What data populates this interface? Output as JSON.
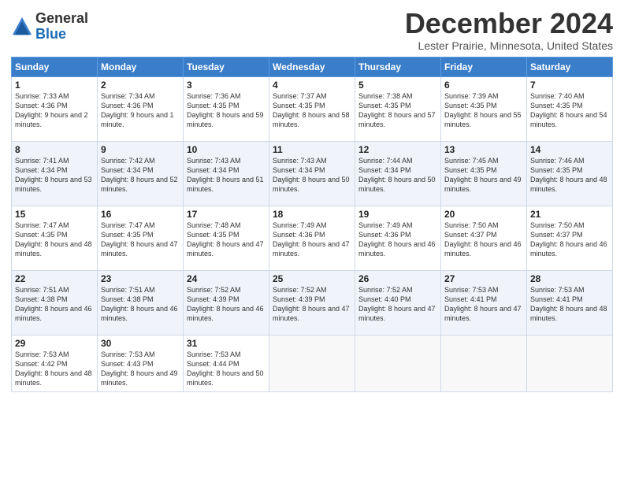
{
  "header": {
    "logo_general": "General",
    "logo_blue": "Blue",
    "month_title": "December 2024",
    "location": "Lester Prairie, Minnesota, United States"
  },
  "weekdays": [
    "Sunday",
    "Monday",
    "Tuesday",
    "Wednesday",
    "Thursday",
    "Friday",
    "Saturday"
  ],
  "weeks": [
    [
      {
        "day": "1",
        "sunrise": "7:33 AM",
        "sunset": "4:36 PM",
        "daylight": "9 hours and 2 minutes."
      },
      {
        "day": "2",
        "sunrise": "7:34 AM",
        "sunset": "4:36 PM",
        "daylight": "9 hours and 1 minute."
      },
      {
        "day": "3",
        "sunrise": "7:36 AM",
        "sunset": "4:35 PM",
        "daylight": "8 hours and 59 minutes."
      },
      {
        "day": "4",
        "sunrise": "7:37 AM",
        "sunset": "4:35 PM",
        "daylight": "8 hours and 58 minutes."
      },
      {
        "day": "5",
        "sunrise": "7:38 AM",
        "sunset": "4:35 PM",
        "daylight": "8 hours and 57 minutes."
      },
      {
        "day": "6",
        "sunrise": "7:39 AM",
        "sunset": "4:35 PM",
        "daylight": "8 hours and 55 minutes."
      },
      {
        "day": "7",
        "sunrise": "7:40 AM",
        "sunset": "4:35 PM",
        "daylight": "8 hours and 54 minutes."
      }
    ],
    [
      {
        "day": "8",
        "sunrise": "7:41 AM",
        "sunset": "4:34 PM",
        "daylight": "8 hours and 53 minutes."
      },
      {
        "day": "9",
        "sunrise": "7:42 AM",
        "sunset": "4:34 PM",
        "daylight": "8 hours and 52 minutes."
      },
      {
        "day": "10",
        "sunrise": "7:43 AM",
        "sunset": "4:34 PM",
        "daylight": "8 hours and 51 minutes."
      },
      {
        "day": "11",
        "sunrise": "7:43 AM",
        "sunset": "4:34 PM",
        "daylight": "8 hours and 50 minutes."
      },
      {
        "day": "12",
        "sunrise": "7:44 AM",
        "sunset": "4:34 PM",
        "daylight": "8 hours and 50 minutes."
      },
      {
        "day": "13",
        "sunrise": "7:45 AM",
        "sunset": "4:35 PM",
        "daylight": "8 hours and 49 minutes."
      },
      {
        "day": "14",
        "sunrise": "7:46 AM",
        "sunset": "4:35 PM",
        "daylight": "8 hours and 48 minutes."
      }
    ],
    [
      {
        "day": "15",
        "sunrise": "7:47 AM",
        "sunset": "4:35 PM",
        "daylight": "8 hours and 48 minutes."
      },
      {
        "day": "16",
        "sunrise": "7:47 AM",
        "sunset": "4:35 PM",
        "daylight": "8 hours and 47 minutes."
      },
      {
        "day": "17",
        "sunrise": "7:48 AM",
        "sunset": "4:35 PM",
        "daylight": "8 hours and 47 minutes."
      },
      {
        "day": "18",
        "sunrise": "7:49 AM",
        "sunset": "4:36 PM",
        "daylight": "8 hours and 47 minutes."
      },
      {
        "day": "19",
        "sunrise": "7:49 AM",
        "sunset": "4:36 PM",
        "daylight": "8 hours and 46 minutes."
      },
      {
        "day": "20",
        "sunrise": "7:50 AM",
        "sunset": "4:37 PM",
        "daylight": "8 hours and 46 minutes."
      },
      {
        "day": "21",
        "sunrise": "7:50 AM",
        "sunset": "4:37 PM",
        "daylight": "8 hours and 46 minutes."
      }
    ],
    [
      {
        "day": "22",
        "sunrise": "7:51 AM",
        "sunset": "4:38 PM",
        "daylight": "8 hours and 46 minutes."
      },
      {
        "day": "23",
        "sunrise": "7:51 AM",
        "sunset": "4:38 PM",
        "daylight": "8 hours and 46 minutes."
      },
      {
        "day": "24",
        "sunrise": "7:52 AM",
        "sunset": "4:39 PM",
        "daylight": "8 hours and 46 minutes."
      },
      {
        "day": "25",
        "sunrise": "7:52 AM",
        "sunset": "4:39 PM",
        "daylight": "8 hours and 47 minutes."
      },
      {
        "day": "26",
        "sunrise": "7:52 AM",
        "sunset": "4:40 PM",
        "daylight": "8 hours and 47 minutes."
      },
      {
        "day": "27",
        "sunrise": "7:53 AM",
        "sunset": "4:41 PM",
        "daylight": "8 hours and 47 minutes."
      },
      {
        "day": "28",
        "sunrise": "7:53 AM",
        "sunset": "4:41 PM",
        "daylight": "8 hours and 48 minutes."
      }
    ],
    [
      {
        "day": "29",
        "sunrise": "7:53 AM",
        "sunset": "4:42 PM",
        "daylight": "8 hours and 48 minutes."
      },
      {
        "day": "30",
        "sunrise": "7:53 AM",
        "sunset": "4:43 PM",
        "daylight": "8 hours and 49 minutes."
      },
      {
        "day": "31",
        "sunrise": "7:53 AM",
        "sunset": "4:44 PM",
        "daylight": "8 hours and 50 minutes."
      },
      null,
      null,
      null,
      null
    ]
  ]
}
